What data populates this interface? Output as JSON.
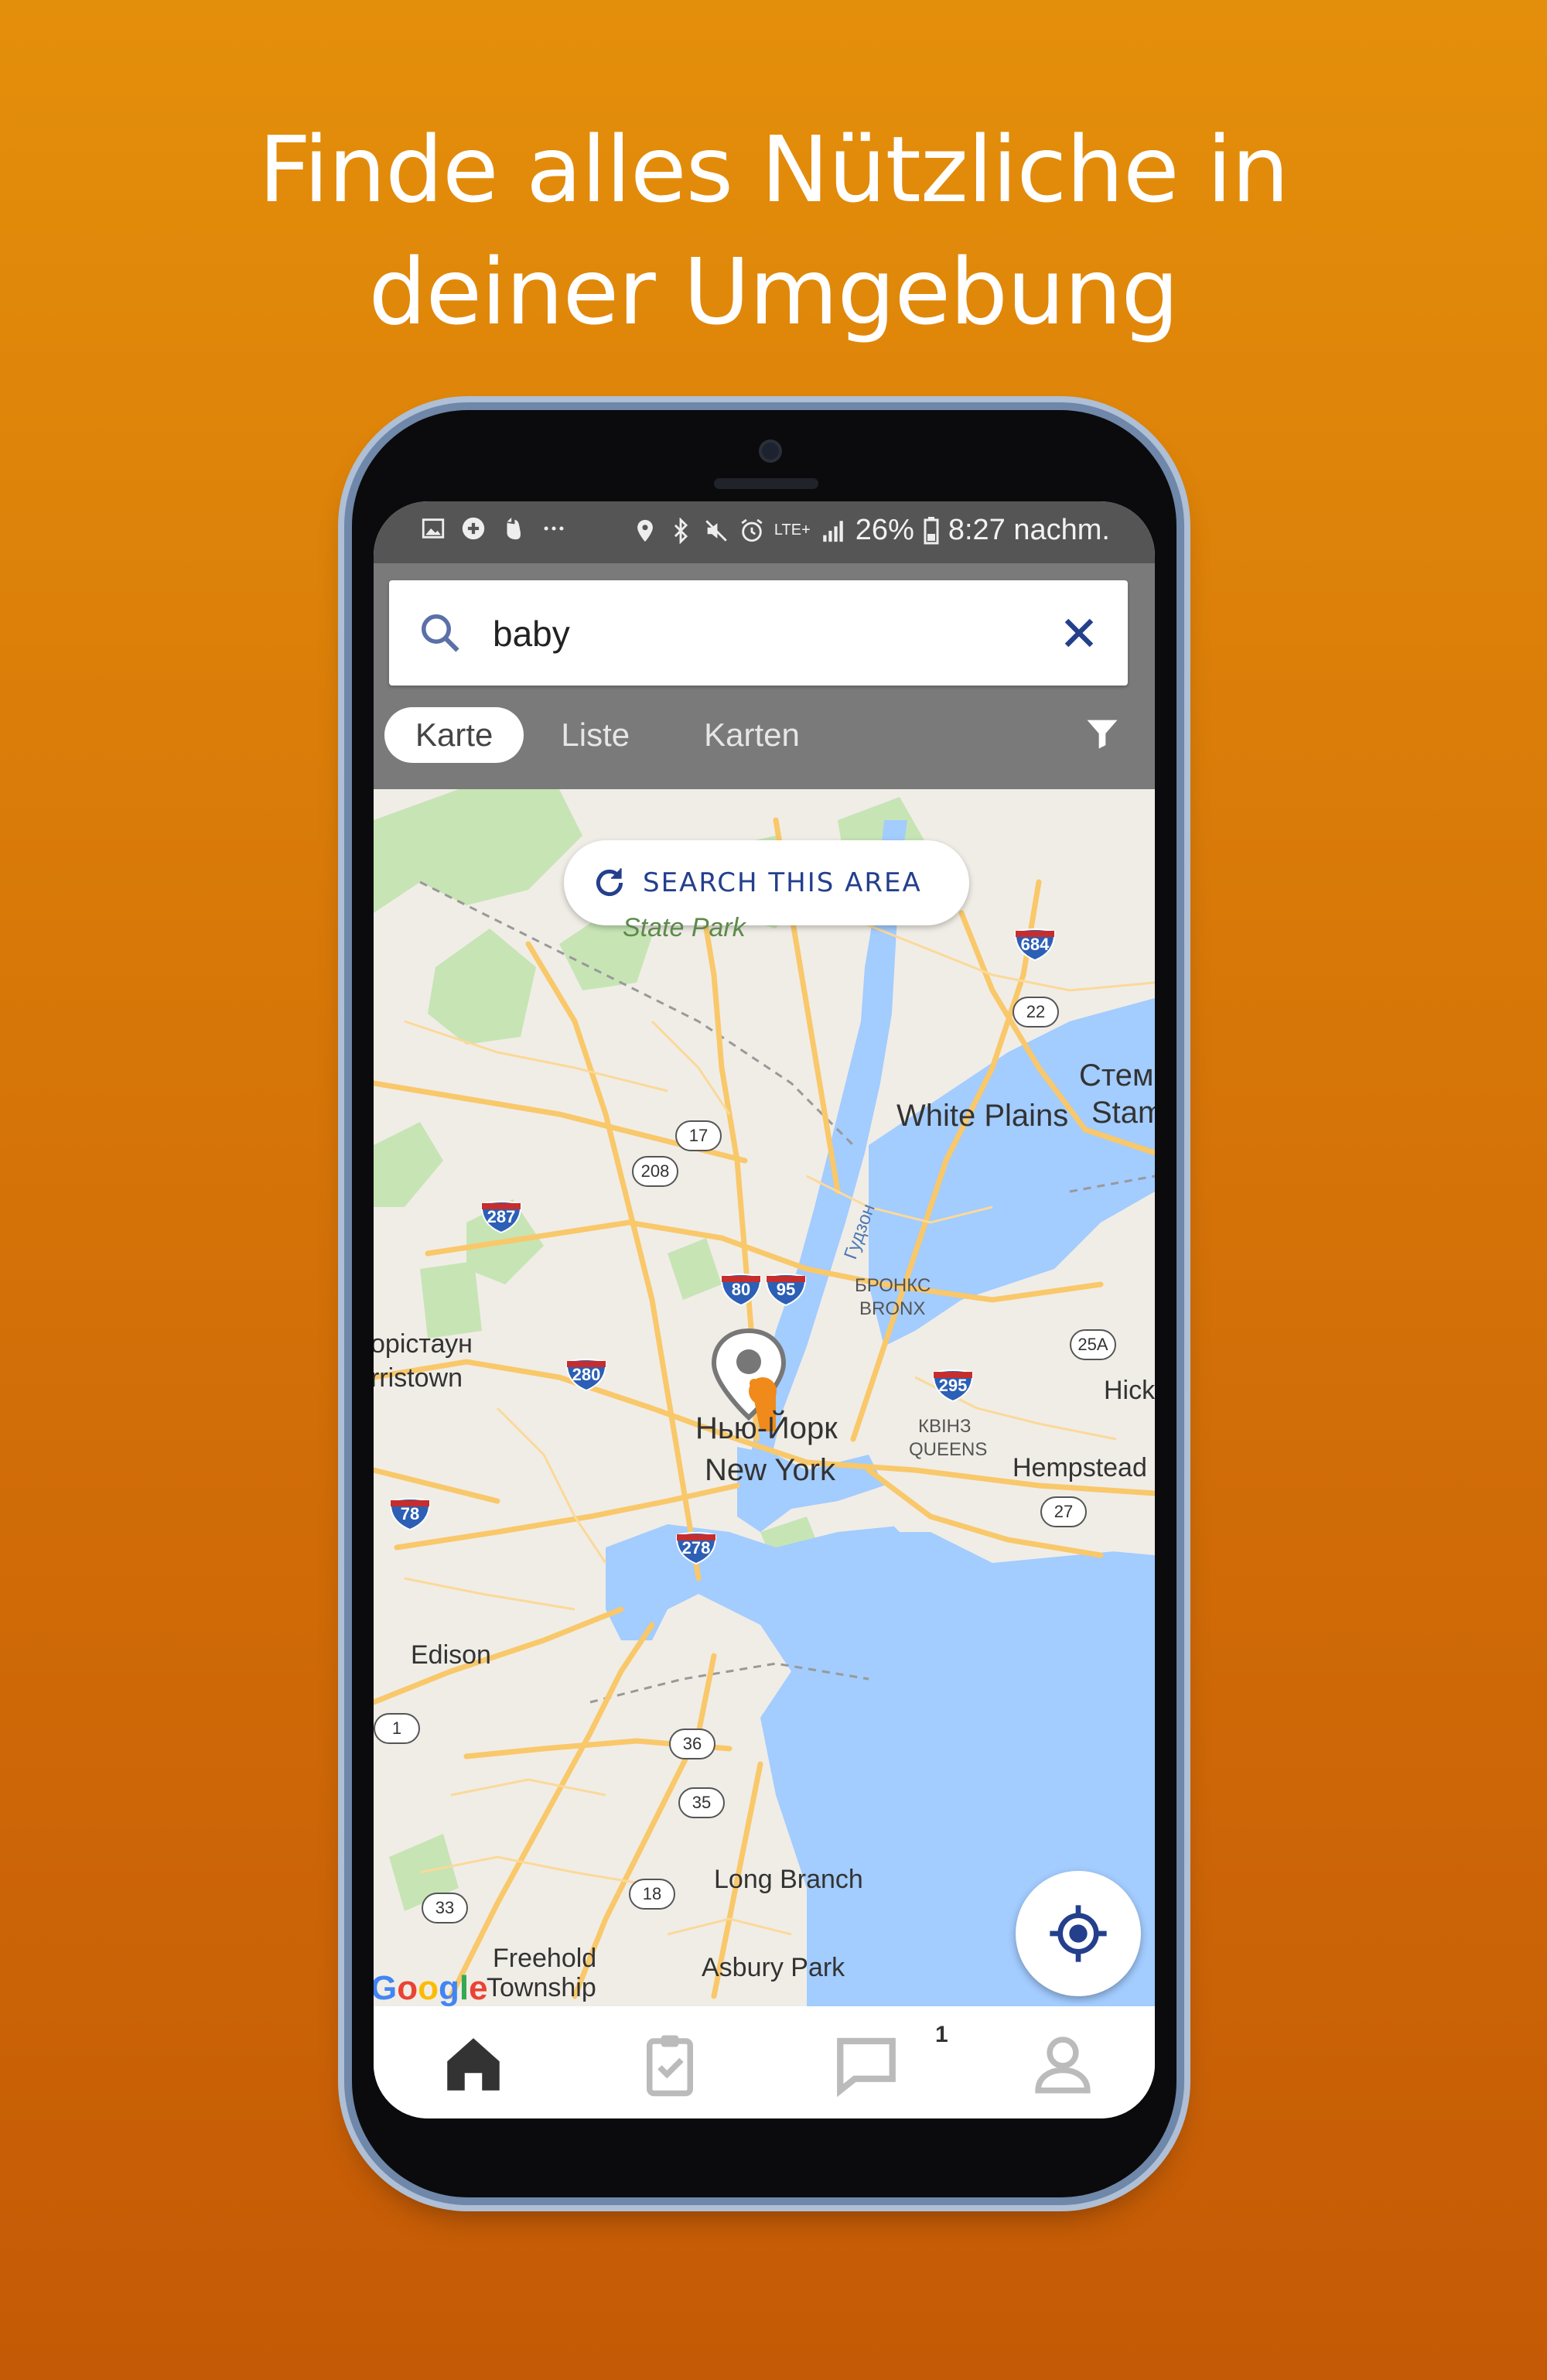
{
  "headline": {
    "line1": "Finde alles Nützliche in",
    "line2": "deiner Umgebung"
  },
  "status_bar": {
    "left_icons": [
      "image-icon",
      "plus-circle-icon",
      "evernote-icon",
      "more-dots-icon"
    ],
    "right_icons": [
      "location-icon",
      "bluetooth-icon",
      "mute-icon",
      "alarm-icon",
      "lte-icon",
      "signal-icon"
    ],
    "network": "LTE+",
    "battery": "26%",
    "time": "8:27 nachm."
  },
  "search": {
    "value": "baby",
    "icon": "search-icon",
    "clear_icon": "close-icon"
  },
  "tabs": [
    {
      "label": "Karte",
      "active": true
    },
    {
      "label": "Liste",
      "active": false
    },
    {
      "label": "Karten",
      "active": false
    }
  ],
  "filter_icon": "filter-icon",
  "map": {
    "search_area_label": "SEARCH THIS AREA",
    "labels": {
      "state_park": "State Park",
      "white_plains": "White Plains",
      "stamford_ru": "Стемф",
      "stamford": "Stam",
      "bronx_ru": "БРОНКС",
      "bronx": "BRONX",
      "morristown_ru": "орістаун",
      "morristown": "rristown",
      "ny_ru": "Нью-Йорк",
      "ny": "New York",
      "queens_ru": "КВІНЗ",
      "queens": "QUEENS",
      "hicksville": "Hick",
      "hempstead": "Hempstead",
      "edison": "Edison",
      "long_branch": "Long Branch",
      "freehold": "Freehold",
      "township": "Township",
      "asbury_park": "Asbury Park",
      "hudson": "Гудзон",
      "google": "Google"
    },
    "interstates": [
      "684",
      "287",
      "80",
      "95",
      "280",
      "295",
      "78",
      "278"
    ],
    "routes": [
      "22",
      "17",
      "208",
      "25A",
      "27",
      "1",
      "36",
      "35",
      "18",
      "33"
    ],
    "marker_icon": "map-pin-icon",
    "my_location_icon": "my-location-icon"
  },
  "bottom_nav": {
    "items": [
      "home-icon",
      "clipboard-check-icon",
      "chat-icon",
      "profile-icon"
    ],
    "chat_badge": "1"
  },
  "colors": {
    "background_top": "#e48f0b",
    "background_bottom": "#c55a06",
    "header_gray": "#7a7a7a",
    "accent_blue": "#243f8c",
    "water": "#a3ccff",
    "road": "#f9c86a",
    "park": "#c7e4b5"
  }
}
